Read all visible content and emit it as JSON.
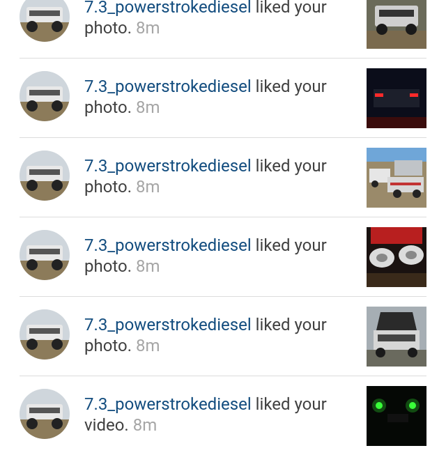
{
  "notifications": [
    {
      "username": "7.3_powerstrokediesel",
      "action": "liked your",
      "object": "photo.",
      "time": "8m",
      "thumb_icon": "truck-front-photo"
    },
    {
      "username": "7.3_powerstrokediesel",
      "action": "liked your",
      "object": "photo.",
      "time": "8m",
      "thumb_icon": "truck-taillights-photo"
    },
    {
      "username": "7.3_powerstrokediesel",
      "action": "liked your",
      "object": "photo.",
      "time": "8m",
      "thumb_icon": "truck-trailer-photo"
    },
    {
      "username": "7.3_powerstrokediesel",
      "action": "liked your",
      "object": "photo.",
      "time": "8m",
      "thumb_icon": "headlights-photo"
    },
    {
      "username": "7.3_powerstrokediesel",
      "action": "liked your",
      "object": "photo.",
      "time": "8m",
      "thumb_icon": "truck-hood-open-photo"
    },
    {
      "username": "7.3_powerstrokediesel",
      "action": "liked your",
      "object": "video.",
      "time": "8m",
      "thumb_icon": "green-lights-video"
    }
  ],
  "colors": {
    "username": "#124c7e",
    "time": "#a6a6a6",
    "text": "#404040",
    "divider": "#dcdcdc"
  }
}
